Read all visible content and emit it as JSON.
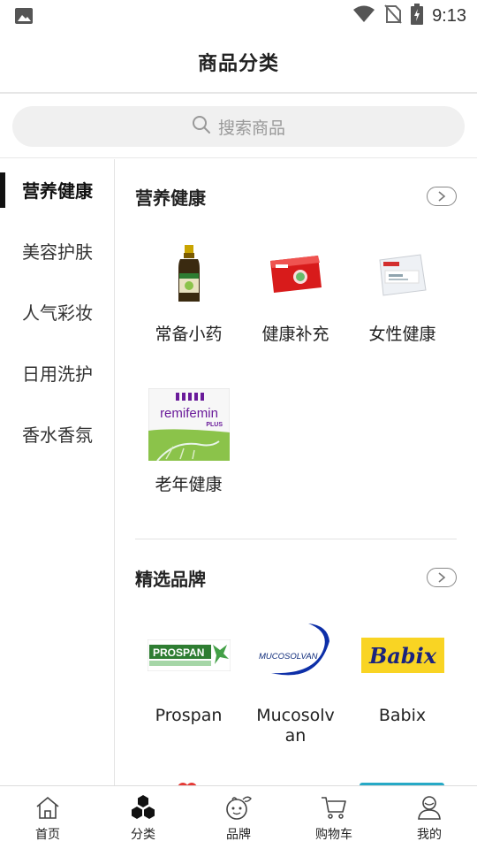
{
  "status_bar": {
    "time": "9:13"
  },
  "header": {
    "title": "商品分类"
  },
  "search": {
    "placeholder": "搜索商品"
  },
  "sidebar": {
    "items": [
      {
        "label": "营养健康",
        "active": true
      },
      {
        "label": "美容护肤",
        "active": false
      },
      {
        "label": "人气彩妆",
        "active": false
      },
      {
        "label": "日用洗护",
        "active": false
      },
      {
        "label": "香水香氛",
        "active": false
      }
    ]
  },
  "sections": [
    {
      "title": "营养健康",
      "items": [
        {
          "label": "常备小药",
          "icon": "medicine-bottle-image"
        },
        {
          "label": "健康补充",
          "icon": "elevit-box-image"
        },
        {
          "label": "女性健康",
          "icon": "vitamin-box-image"
        },
        {
          "label": "老年健康",
          "icon": "remifemin-box-image"
        }
      ]
    },
    {
      "title": "精选品牌",
      "items": [
        {
          "label": "Prospan",
          "icon": "prospan-logo"
        },
        {
          "label": "Mucosolvan",
          "icon": "mucosolvan-logo"
        },
        {
          "label": "Babix",
          "icon": "babix-logo"
        }
      ]
    }
  ],
  "logos": {
    "remifemin": "remifemin",
    "remifemin_sub": "PLUS",
    "prospan": "PROSPAN",
    "mucosolvan": "MUCOSOLVAN",
    "babix": "Babix"
  },
  "bottom_nav": [
    {
      "label": "首页",
      "icon": "home-icon"
    },
    {
      "label": "分类",
      "icon": "category-icon"
    },
    {
      "label": "品牌",
      "icon": "brand-icon"
    },
    {
      "label": "购物车",
      "icon": "cart-icon"
    },
    {
      "label": "我的",
      "icon": "profile-icon"
    }
  ]
}
